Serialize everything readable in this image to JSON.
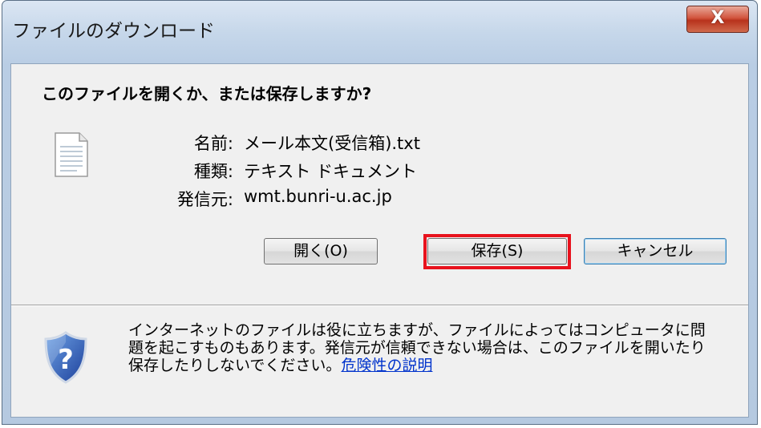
{
  "dialog": {
    "title": "ファイルのダウンロード",
    "close_label": "X"
  },
  "content": {
    "question": "このファイルを開くか、または保存しますか?",
    "file": {
      "icon": "text-file-icon",
      "name_label": "名前:",
      "name_value": "メール本文(受信箱).txt",
      "type_label": "種類:",
      "type_value": "テキスト ドキュメント",
      "from_label": "発信元:",
      "from_value": "wmt.bunri-u.ac.jp"
    },
    "buttons": {
      "open": "開く(O)",
      "save": "保存(S)",
      "cancel": "キャンセル"
    },
    "warning": {
      "icon": "shield-question-icon",
      "text": "インターネットのファイルは役に立ちますが、ファイルによってはコンピュータに問題を起こすものもあります。発信元が信頼できない場合は、このファイルを開いたり保存したりしないでください。",
      "link": "危険性の説明"
    }
  },
  "colors": {
    "highlight": "#e8121d",
    "link": "#0033cc",
    "close_button": "#c8432a"
  }
}
